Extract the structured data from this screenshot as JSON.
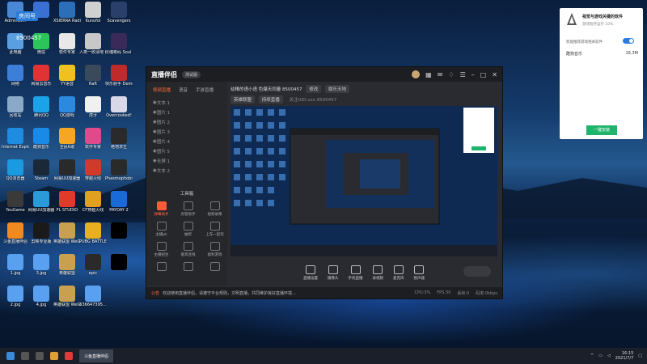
{
  "desktop": {
    "icons": [
      {
        "label": "Administ...",
        "color": "#4a88d6"
      },
      {
        "label": "",
        "color": "#3a6fd4"
      },
      {
        "label": "XSIERRA Radio",
        "color": "#2a6fb8"
      },
      {
        "label": "Kunofol",
        "color": "#d0d0d0"
      },
      {
        "label": "Scavengers",
        "color": "#2a3f6a"
      },
      {
        "label": "此电脑",
        "color": "#5aa0e0"
      },
      {
        "label": "微信",
        "color": "#2bc55a"
      },
      {
        "label": "软件专家",
        "color": "#e8e8e8"
      },
      {
        "label": "人类一败涂地 Human Fal...",
        "color": "#c8c8c8"
      },
      {
        "label": "灵魂筹码 Soul D...",
        "color": "#3a2a5a"
      },
      {
        "label": "网络",
        "color": "#3d7fd8"
      },
      {
        "label": "网易云音乐",
        "color": "#e03434"
      },
      {
        "label": "YY语音",
        "color": "#f0c020"
      },
      {
        "label": "Raft",
        "color": "#3a4a5a"
      },
      {
        "label": "快乐射手 Demo",
        "color": "#c02a2a"
      },
      {
        "label": "回收站",
        "color": "#8aa8c8"
      },
      {
        "label": "腾讯QQ",
        "color": "#1aa3e8"
      },
      {
        "label": "QQ游戏",
        "color": "#2a8ae0"
      },
      {
        "label": "虎牙",
        "color": "#f0f0f0"
      },
      {
        "label": "Overcooked!",
        "color": "#d8d8e8"
      },
      {
        "label": "Internet Explorer",
        "color": "#1e8ce0"
      },
      {
        "label": "酷狗音乐",
        "color": "#1a8ae8"
      },
      {
        "label": "全民K歌",
        "color": "#f5a623"
      },
      {
        "label": "软件专家",
        "color": "#e04a8a"
      },
      {
        "label": "绝地求生",
        "color": "#2a2a2a"
      },
      {
        "label": "QQ浏览器",
        "color": "#1a9ae0"
      },
      {
        "label": "Steam",
        "color": "#1b2838"
      },
      {
        "label": "网易UU加速器",
        "color": "#2a2a2a"
      },
      {
        "label": "穿越火线",
        "color": "#d03a2a"
      },
      {
        "label": "Phasmophobia",
        "color": "#2a2a2a"
      },
      {
        "label": "YouGame",
        "color": "#3a3a3a"
      },
      {
        "label": "网易UU加速器",
        "color": "#2a9ad8"
      },
      {
        "label": "FL STUDIO",
        "color": "#e03a2a"
      },
      {
        "label": "CF穿越火线",
        "color": "#e0a020"
      },
      {
        "label": "PAYDAY 2",
        "color": "#1a6ad8"
      },
      {
        "label": "斗鱼直播伴侣",
        "color": "#f08a20"
      },
      {
        "label": "剪映专业版",
        "color": "#1a1a1a"
      },
      {
        "label": "英雄联盟 WeGame版",
        "color": "#c8a050"
      },
      {
        "label": "PUBG BATTLEGR...",
        "color": "#e8b020"
      },
      {
        "label": "",
        "color": "#000000"
      },
      {
        "label": "1.jpg",
        "color": "#5aa0f0"
      },
      {
        "label": "3.jpg",
        "color": "#5aa0f0"
      },
      {
        "label": "英雄联盟",
        "color": "#c8a050"
      },
      {
        "label": "epic",
        "color": "#2a2a2a"
      },
      {
        "label": "",
        "color": "#000000"
      },
      {
        "label": "2.jpg",
        "color": "#5aa0f0"
      },
      {
        "label": "4.jpg",
        "color": "#5aa0f0"
      },
      {
        "label": "英雄联盟 WeGame版",
        "color": "#c8a050"
      },
      {
        "label": "636647395...",
        "color": "#5aa0f0"
      }
    ],
    "room_badge": "房间号",
    "room_number": "8500457"
  },
  "window": {
    "title": "直播伴侣",
    "version": "测试版",
    "tabs": [
      "视频直播",
      "语音",
      "手游直播"
    ],
    "scenes": [
      "文本 1",
      "图片 1",
      "图片 2",
      "图片 3",
      "图片 4",
      "图片 5",
      "全屏 1",
      "文本 2"
    ],
    "toolbox_title": "工具箱",
    "tools": [
      "弹幕助手",
      "房管助手",
      "视频录像",
      "主播pk",
      "抽奖",
      "上车一起玩",
      "主播招生",
      "嘉宾连线",
      "福利游戏",
      "",
      "",
      ""
    ],
    "stream_title": "幼稚的语小语 色爆天同量 8500457",
    "edit_label": "修改",
    "category_label": "娱乐天地",
    "tag1": "英雄联盟",
    "tag2": "持续直播",
    "uid_text": "关注UID:xxx 8500457",
    "controls": [
      "直播设置",
      "摄像头",
      "手机直播",
      "录视频",
      "麦克风",
      "扬声器"
    ],
    "start_label": "开始直播",
    "notice_tag": "公告",
    "notice_text": "欢迎使用直播伴侣，请遵守平台规则，文明直播，共同维护良好直播环境...",
    "stats": [
      "CPU:3%",
      "FPS:30",
      "丢帧:0",
      "码率:0kbps"
    ]
  },
  "panel": {
    "title": "视觉与游戏关键的软件",
    "subtitle": "游戏程序运行 10%",
    "checkbox_label": "智能推荐游戏相关软件",
    "item_name": "酷狗音乐",
    "item_size": "16.3M",
    "install_label": "一键安装"
  },
  "taskbar": {
    "app_label": "斗鱼直播伴侣",
    "time": "16:15",
    "date": "2021/7/7"
  }
}
